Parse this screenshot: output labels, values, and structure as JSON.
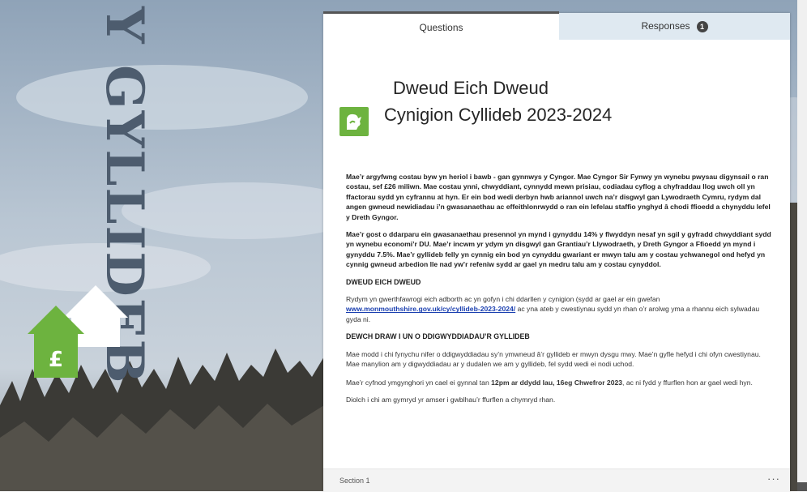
{
  "background": {
    "banner_text": "Y GYLLIDEB",
    "house_symbol": "£",
    "colors": {
      "sky": "#aebccb",
      "banner": "#4d5c6e",
      "house_green": "#6db33f"
    }
  },
  "tabs": {
    "questions": "Questions",
    "responses": "Responses",
    "responses_count": "1"
  },
  "form": {
    "logo_icon": "monmouthshire-logo-icon",
    "title_line1": "Dweud Eich Dweud",
    "title_line2": "Cynigion Cyllideb 2023-2024",
    "paragraph1": "Mae’r argyfwng costau byw yn heriol i bawb - gan gynnwys y Cyngor. Mae Cyngor Sir Fynwy yn wynebu pwysau digynsail o ran costau, sef £26 miliwn. Mae costau ynni, chwyddiant, cynnydd mewn prisiau, codiadau cyflog a chyfraddau llog uwch oll yn ffactorau sydd yn cyfrannu at hyn. Er ein bod wedi derbyn hwb ariannol uwch na’r disgwyl gan Lywodraeth Cymru, rydym dal angen gwneud newidiadau i’n gwasanaethau ac effeithlonrwydd o ran ein lefelau staffio ynghyd â chodi ffioedd a chynyddu lefel y Dreth Gyngor.",
    "paragraph2": "Mae’r gost o ddarparu ein gwasanaethau presennol yn mynd i gynyddu 14% y flwyddyn nesaf yn sgil y gyfradd chwyddiant sydd yn wynebu economi’r DU. Mae’r incwm yr ydym yn disgwyl gan Grantiau’r Llywodraeth, y Dreth Gyngor a Ffioedd yn mynd i gynyddu  7.5%. Mae’r gyllideb felly yn cynnig ein bod yn cynyddu gwariant er mwyn talu am y costau ychwanegol ond hefyd yn cynnig gwneud arbedion lle nad yw’r refeniw sydd ar gael yn medru talu am y costau cynyddol.",
    "heading1": "DWEUD EICH DWEUD",
    "text1_pre": "Rydym yn gwerthfawrogi eich adborth ac yn gofyn i chi ddarllen y cynigion (sydd ar gael ar ein gwefan ",
    "link": "www.monmouthshire.gov.uk/cy/cyllideb-2023-2024/",
    "text1_post": "  ac yna ateb y cwestiynau sydd yn rhan o’r arolwg yma a rhannu eich sylwadau gyda ni.",
    "heading2": "DEWCH DRAW I UN O DDIGWYDDIADAU’R GYLLIDEB",
    "text2": "Mae modd i chi fynychu nifer o ddigwyddiadau sy’n ymwneud â’r gyllideb er mwyn dysgu mwy. Mae’n gyfle hefyd i chi ofyn cwestiynau. Mae manylion am y digwyddiadau ar y dudalen we am y gyllideb, fel sydd wedi ei nodi uchod.",
    "text3_pre": "Mae’r cyfnod ymgynghori yn cael ei gynnal tan  ",
    "text3_bold": "12pm ar ddydd Iau, 16eg Chwefror 2023",
    "text3_post": ",  ac ni fydd y ffurflen hon ar gael wedi hyn.",
    "text4": "Diolch i chi am gymryd yr amser i gwblhau’r ffurflen a chymryd rhan."
  },
  "section": {
    "label": "Section 1",
    "more": "···"
  }
}
